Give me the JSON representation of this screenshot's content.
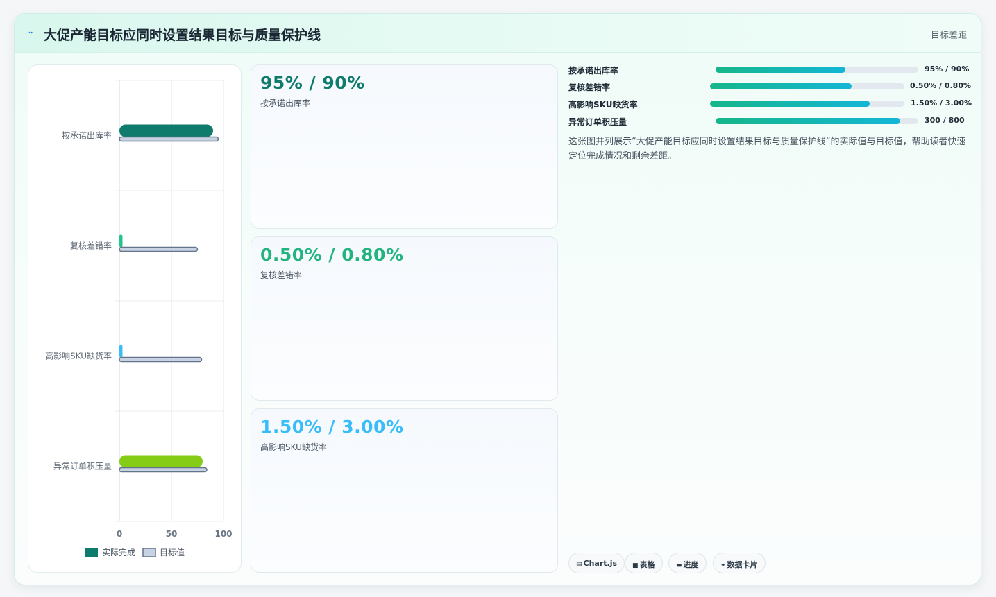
{
  "header": {
    "title": "大促产能目标应同时设置结果目标与质量保护线",
    "tag": "目标差距",
    "icon": "spark-icon"
  },
  "colors": {
    "series_actual": [
      "#0f7b6c",
      "#22c38e",
      "#38bdf8",
      "#84cc16"
    ],
    "series_target_fill": "#c7d3e2",
    "series_target_stroke": "#64748b",
    "progress_start": "#16b68a",
    "progress_end": "#13b6d6"
  },
  "chart_data": {
    "type": "bar",
    "orientation": "horizontal",
    "categories": [
      "按承诺出库率",
      "复核差错率",
      "高影响SKU缺货率",
      "异常订单积压量"
    ],
    "series": [
      {
        "name": "实际完成",
        "values": [
          90,
          3,
          3,
          80
        ]
      },
      {
        "name": "目标值",
        "values": [
          95,
          75,
          79,
          84
        ]
      }
    ],
    "xlim": [
      0,
      100
    ],
    "xticks": [
      0,
      50,
      100
    ],
    "grid": true,
    "legend": "bottom"
  },
  "kpis": [
    {
      "value": "95% / 90%",
      "label": "按承诺出库率",
      "color": "#0f7b6c"
    },
    {
      "value": "0.50% / 0.80%",
      "label": "复核差错率",
      "color": "#22b37f"
    },
    {
      "value": "1.50% / 3.00%",
      "label": "高影响SKU缺货率",
      "color": "#38bdf8"
    }
  ],
  "progress": [
    {
      "label": "按承诺出库率",
      "value": "95% / 90%",
      "fraction": 0.64
    },
    {
      "label": "复核差错率",
      "value": "0.50% / 0.80%",
      "fraction": 0.73
    },
    {
      "label": "高影响SKU缺货率",
      "value": "1.50% / 3.00%",
      "fraction": 0.82
    },
    {
      "label": "异常订单积压量",
      "value": "300 / 800",
      "fraction": 0.91
    }
  ],
  "description": "这张图并列展示“大促产能目标应同时设置结果目标与质量保护线”的实际值与目标值，帮助读者快速定位完成情况和剩余差距。",
  "chips": [
    {
      "icon": "chart-icon",
      "glyph": "▤",
      "label": "Chart.js"
    },
    {
      "icon": "table-icon",
      "glyph": "■",
      "label": "表格"
    },
    {
      "icon": "progress-icon",
      "glyph": "▬",
      "label": "进度"
    },
    {
      "icon": "card-icon",
      "glyph": "✦",
      "label": "数据卡片"
    }
  ]
}
